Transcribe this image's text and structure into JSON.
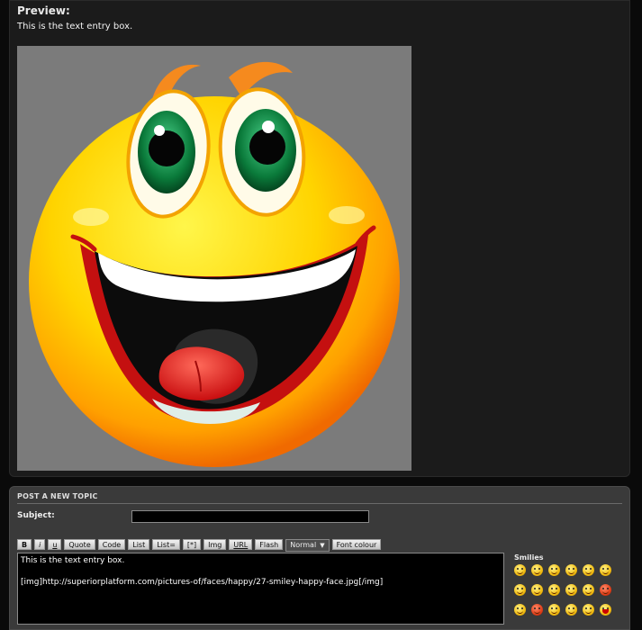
{
  "preview": {
    "title": "Preview:",
    "text": "This is the text entry box."
  },
  "post": {
    "header": "POST A NEW TOPIC",
    "subject_label": "Subject:",
    "subject_value": "",
    "toolbar": {
      "bold": "B",
      "italic": "i",
      "underline": "u",
      "quote": "Quote",
      "code": "Code",
      "list": "List",
      "list_ordered": "List=",
      "list_item": "[*]",
      "img": "Img",
      "url": "URL",
      "flash": "Flash",
      "font_size": "Normal",
      "font_colour": "Font colour"
    },
    "editor_line1": "This is the text entry box.",
    "editor_line2": "[img]http://superiorplatform.com/pictures-of/faces/happy/27-smiley-happy-face.jpg[/img]",
    "smilies_title": "Smilies"
  },
  "colors": {
    "background": "#0a0a0a",
    "panel": "#1b1b1b",
    "post_panel": "#3a3a3a",
    "smiley_yellow": "#f2bd12"
  }
}
